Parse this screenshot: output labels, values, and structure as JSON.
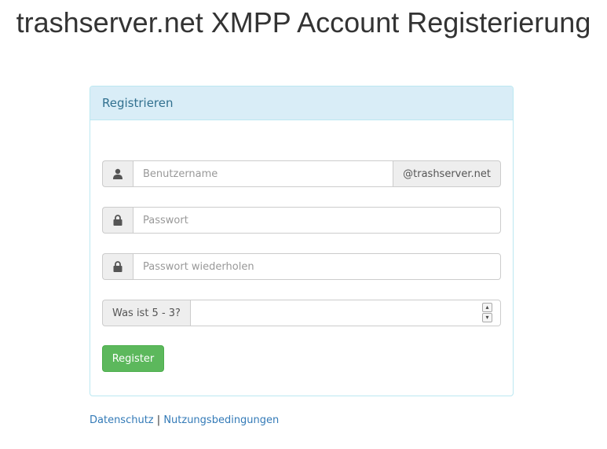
{
  "page": {
    "title": "trashserver.net XMPP Account Registerierung"
  },
  "panel": {
    "heading": "Registrieren"
  },
  "form": {
    "username": {
      "placeholder": "Benutzername",
      "value": "",
      "icon": "user-icon",
      "suffix": "@trashserver.net"
    },
    "password": {
      "placeholder": "Passwort",
      "value": "",
      "icon": "lock-icon"
    },
    "password_repeat": {
      "placeholder": "Passwort wiederholen",
      "value": "",
      "icon": "lock-icon"
    },
    "captcha": {
      "question": "Was ist 5 - 3?",
      "value": ""
    },
    "submit_label": "Register"
  },
  "footer": {
    "privacy_link": "Datenschutz",
    "separator": "|",
    "terms_link": "Nutzungsbedingungen"
  },
  "colors": {
    "panel_border": "#bce8f1",
    "panel_heading_bg": "#d9edf7",
    "panel_heading_text": "#31708f",
    "button_bg": "#5cb85c",
    "link": "#337ab7"
  }
}
